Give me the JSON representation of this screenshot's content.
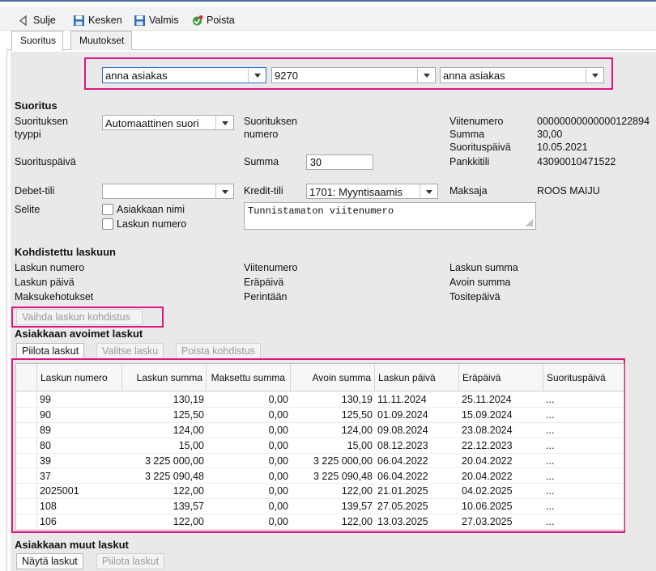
{
  "toolbar": {
    "close": "Sulje",
    "pause": "Kesken",
    "done": "Valmis",
    "delete": "Poista"
  },
  "tabs": [
    "Suoritus",
    "Muutokset"
  ],
  "filters": {
    "customer1": "anna asiakas",
    "number": "9270",
    "customer2": "anna asiakas"
  },
  "suoritus": {
    "heading": "Suoritus",
    "type_label": "Suorituksen tyyppi",
    "type_value": "Automaattinen suori",
    "payment_number_label": "Suorituksen numero",
    "date_label": "Suorituspäivä",
    "sum_label": "Summa",
    "sum_value": "30",
    "debet_label": "Debet-tili",
    "debet_value": "",
    "kredit_label": "Kredit-tili",
    "kredit_value": "1701: Myyntisaamis",
    "payer_label": "Maksaja",
    "payer_value": "ROOS MAIJU",
    "memo_label": "Selite",
    "memo_value": "Tunnistamaton viitenumero",
    "chk_customer_name": "Asiakkaan nimi",
    "chk_invoice_number": "Laskun numero",
    "info": {
      "ref_label": "Viitenumero",
      "ref_value": "00000000000000122894",
      "sum_label": "Summa",
      "sum_value": "30,00",
      "date_label": "Suorituspäivä",
      "date_value": "10.05.2021",
      "bank_label": "Pankkitili",
      "bank_value": "43090010471522"
    }
  },
  "allocated": {
    "heading": "Kohdistettu laskuun",
    "invoice_number": "Laskun numero",
    "invoice_date": "Laskun päivä",
    "reminders": "Maksukehotukset",
    "ref": "Viitenumero",
    "due": "Eräpäivä",
    "collection": "Perintään",
    "invoice_sum": "Laskun summa",
    "open_sum": "Avoin summa",
    "voucher_date": "Tositepäivä",
    "change_btn": "Vaihda laskun kohdistus"
  },
  "open_invoices": {
    "heading": "Asiakkaan avoimet laskut",
    "btn_hide": "Piilota laskut",
    "btn_select": "Valitse lasku",
    "btn_remove": "Poista kohdistus",
    "columns": [
      "Laskun numero",
      "Laskun summa",
      "Maksettu summa",
      "Avoin summa",
      "Laskun päivä",
      "Eräpäivä",
      "Suorituspäivä"
    ],
    "rows": [
      [
        "99",
        "130,19",
        "0,00",
        "130,19",
        "11.11.2024",
        "25.11.2024",
        "..."
      ],
      [
        "90",
        "125,50",
        "0,00",
        "125,50",
        "01.09.2024",
        "15.09.2024",
        "..."
      ],
      [
        "89",
        "124,00",
        "0,00",
        "124,00",
        "09.08.2024",
        "23.08.2024",
        "..."
      ],
      [
        "80",
        "15,00",
        "0,00",
        "15,00",
        "08.12.2023",
        "22.12.2023",
        "..."
      ],
      [
        "39",
        "3 225 000,00",
        "0,00",
        "3 225 000,00",
        "06.04.2022",
        "20.04.2022",
        "..."
      ],
      [
        "37",
        "3 225 090,48",
        "0,00",
        "3 225 090,48",
        "06.04.2022",
        "20.04.2022",
        "..."
      ],
      [
        "2025001",
        "122,00",
        "0,00",
        "122,00",
        "21.01.2025",
        "04.02.2025",
        "..."
      ],
      [
        "108",
        "139,57",
        "0,00",
        "139,57",
        "27.05.2025",
        "10.06.2025",
        "..."
      ],
      [
        "106",
        "122,00",
        "0,00",
        "122,00",
        "13.03.2025",
        "27.03.2025",
        "..."
      ]
    ]
  },
  "other_invoices": {
    "heading": "Asiakkaan muut laskut",
    "btn_show": "Näytä laskut",
    "btn_hide": "Piilota laskut"
  }
}
